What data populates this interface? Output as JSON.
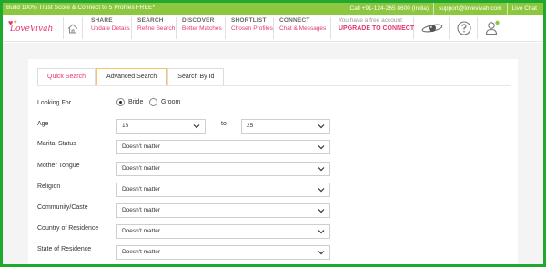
{
  "topbar": {
    "promo": "Build 100% Trust Score & Connect to 5 Profiles FREE*",
    "phone": "Call +91-124-265 8600 (India)",
    "email": "support@lovevivah.com",
    "chat": "Live Chat"
  },
  "brand": {
    "logo_text": "LoveVivah",
    "accent": "#e2386e",
    "topbar_color": "#8dc63f",
    "frame_color": "#1faa2f"
  },
  "nav": {
    "home_icon": "home-icon",
    "items": [
      {
        "title": "SHARE",
        "sub": "Update Details"
      },
      {
        "title": "SEARCH",
        "sub": "Refine Search"
      },
      {
        "title": "DISCOVER",
        "sub": "Better Matches"
      },
      {
        "title": "SHORTLIST",
        "sub": "Chosen Profiles"
      },
      {
        "title": "CONNECT",
        "sub": "Chat & Messages"
      }
    ],
    "upgrade": {
      "title": "You have a free account",
      "sub": "UPGRADE TO CONNECT"
    },
    "icons": [
      "planet-icon",
      "help-icon",
      "user-icon"
    ]
  },
  "tabs": [
    {
      "label": "Quick Search",
      "active": true
    },
    {
      "label": "Advanced Search",
      "active": false
    },
    {
      "label": "Search By Id",
      "active": false
    }
  ],
  "form": {
    "looking_for": {
      "label": "Looking For",
      "options": [
        "Bride",
        "Groom"
      ],
      "selected": "Bride"
    },
    "age": {
      "label": "Age",
      "from": "18",
      "to_label": "to",
      "to": "25"
    },
    "fields": [
      {
        "label": "Marital Status",
        "value": "Doesn't matter"
      },
      {
        "label": "Mother Tongue",
        "value": "Doesn't matter"
      },
      {
        "label": "Religion",
        "value": "Doesn't matter"
      },
      {
        "label": "Community/Caste",
        "value": "Doesn't matter"
      },
      {
        "label": "Country of Residence",
        "value": "Doesn't matter"
      },
      {
        "label": "State of Residence",
        "value": "Doesn't matter"
      }
    ]
  }
}
